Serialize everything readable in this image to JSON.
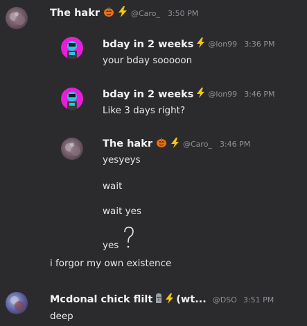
{
  "messages": [
    {
      "author": "The hakr",
      "handle": "@Caro_",
      "time": "3:50 PM"
    },
    {
      "author": "bday in 2 weeks",
      "handle": "@lon99",
      "time": "3:36 PM",
      "text": "your bday sooooon"
    },
    {
      "author": "bday in 2 weeks",
      "handle": "@lon99",
      "time": "3:46 PM",
      "text": "Like 3 days right?"
    },
    {
      "author": "The hakr",
      "handle": "@Caro_",
      "time": "3:46 PM",
      "lines": [
        "yesyeys",
        "wait",
        "wait yes",
        "yes"
      ]
    },
    {
      "text": "i forgor my own existence"
    },
    {
      "author": "Mcdonal chick flilt",
      "author_suffix": "(wt...",
      "handle": "@DSO",
      "time": "3:51 PM",
      "text": "deep"
    }
  ],
  "colors": {
    "background": "#2b2b2e",
    "bolt": "#f5c518",
    "pumpkin": "#e8701a",
    "muted": "#8e9297"
  },
  "icons": [
    "pumpkin-icon",
    "lightning-icon",
    "question-mark-icon",
    "moai-icon"
  ]
}
